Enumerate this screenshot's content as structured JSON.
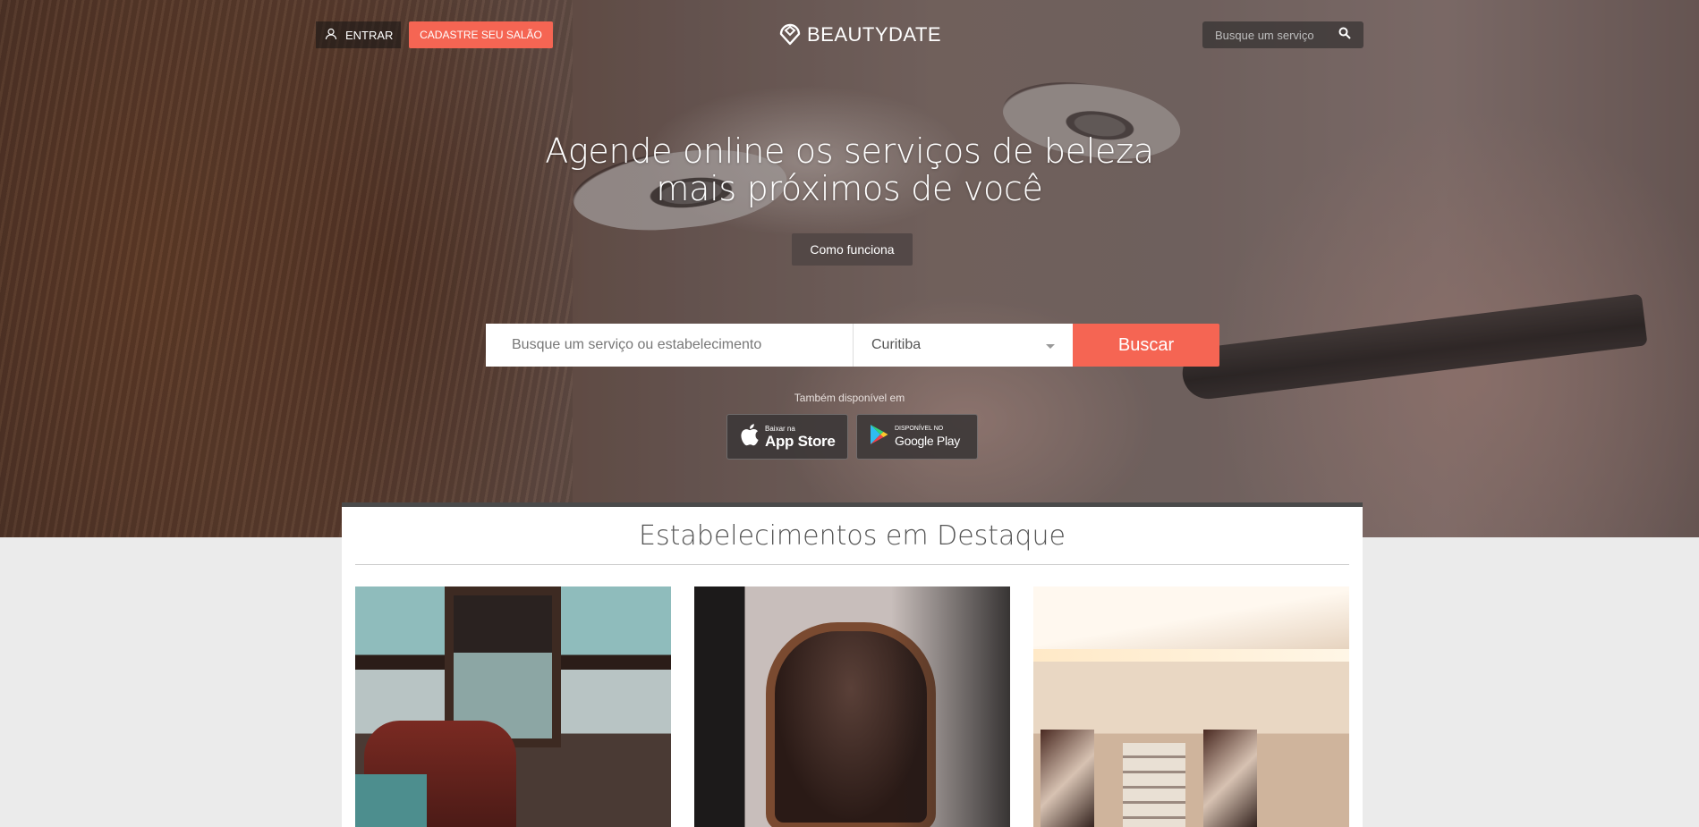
{
  "header": {
    "login_label": "ENTRAR",
    "register_label": "CADASTRE SEU SALÃO",
    "logo_text": "BEAUTYDATE",
    "search_placeholder": "Busque um serviço"
  },
  "hero": {
    "headline_line1": "Agende online os serviços de beleza",
    "headline_line2": "mais próximos de você",
    "how_it_works_label": "Como funciona",
    "search_placeholder": "Busque um serviço ou estabelecimento",
    "city_value": "Curitiba",
    "search_button_label": "Buscar",
    "available_text": "Também disponível em",
    "app_store": {
      "small": "Baixar na",
      "big": "App Store"
    },
    "google_play": {
      "small": "DISPONÍVEL NO",
      "big": "Google Play"
    }
  },
  "featured": {
    "title": "Estabelecimentos em Destaque"
  },
  "colors": {
    "accent": "#f56553",
    "featured_border": "#4a4a4a",
    "page_bg": "#ebebeb"
  },
  "icons": [
    "user-icon",
    "logo-pin-icon",
    "search-icon",
    "chevron-down-icon",
    "apple-icon",
    "google-play-icon"
  ]
}
